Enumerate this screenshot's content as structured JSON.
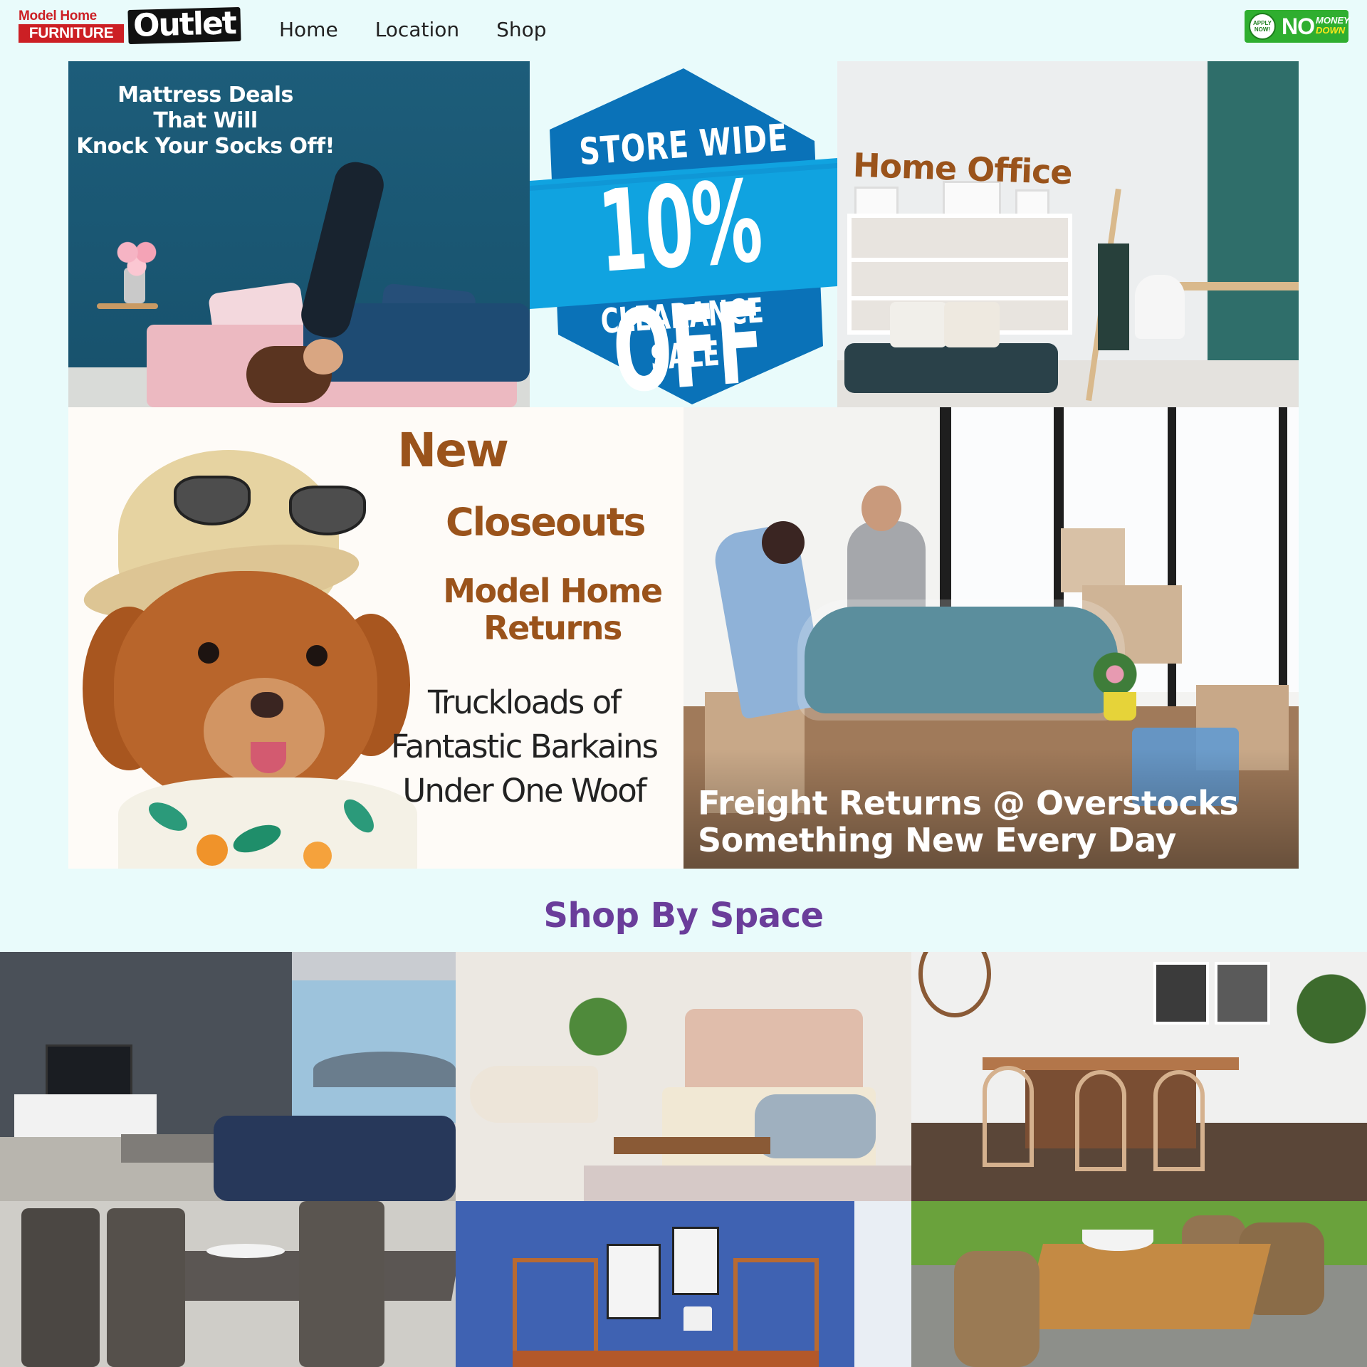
{
  "header": {
    "logo_top": "Model Home",
    "logo_bottom": "FURNITURE",
    "logo_outlet": "Outlet",
    "nav": [
      "Home",
      "Location",
      "Shop"
    ],
    "badge": {
      "circle": "APPLY NOW!",
      "no": "NO",
      "money": "MONEY",
      "down": "DOWN"
    }
  },
  "hero": {
    "mattress": "Mattress Deals\nThat Will\nKnock Your Socks Off!",
    "sale": {
      "line1": "STORE WIDE",
      "line2": "10% OFF",
      "line3": "CLEARANCE SALE",
      "colors": {
        "dark": "#0a72b8",
        "band": "#10a3e0"
      }
    },
    "office_title": "Home Office",
    "dog": {
      "t1": "New",
      "t2": "Closeouts",
      "t3": "Model Home\nReturns",
      "t4": "Truckloads of\nFantastic Barkains\nUnder One Woof"
    },
    "freight": "Freight Returns @ Overstocks\nSomething New Every Day"
  },
  "shop_by_space": {
    "title": "Shop By Space",
    "accent": "#6a3d9a",
    "tiles": [
      "living-room",
      "bedroom",
      "dining-room",
      "dining-set",
      "home-office",
      "outdoor-patio"
    ]
  }
}
